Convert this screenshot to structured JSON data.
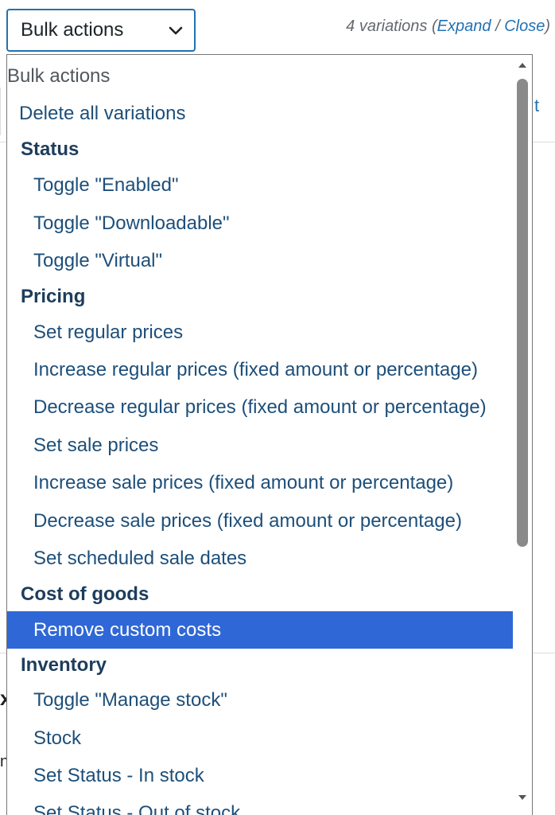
{
  "select": {
    "label": "Bulk actions",
    "icon": "chevron-down-icon"
  },
  "variations": {
    "count_text": "4 variations",
    "open_paren": "(",
    "expand_label": "Expand",
    "separator": " / ",
    "close_label": "Close",
    "close_paren": ")"
  },
  "background": {
    "fragment_right": "t",
    "fragment_heading": "x",
    "fragment_text": "n"
  },
  "dropdown": {
    "options": [
      {
        "label": "Bulk actions",
        "kind": "placeholder"
      },
      {
        "label": "Delete all variations",
        "kind": "top-level"
      },
      {
        "label": "Status",
        "kind": "group"
      },
      {
        "label": "Toggle \"Enabled\"",
        "kind": "child"
      },
      {
        "label": "Toggle \"Downloadable\"",
        "kind": "child"
      },
      {
        "label": "Toggle \"Virtual\"",
        "kind": "child"
      },
      {
        "label": "Pricing",
        "kind": "group"
      },
      {
        "label": "Set regular prices",
        "kind": "child"
      },
      {
        "label": "Increase regular prices (fixed amount or percentage)",
        "kind": "child"
      },
      {
        "label": "Decrease regular prices (fixed amount or percentage)",
        "kind": "child"
      },
      {
        "label": "Set sale prices",
        "kind": "child"
      },
      {
        "label": "Increase sale prices (fixed amount or percentage)",
        "kind": "child"
      },
      {
        "label": "Decrease sale prices (fixed amount or percentage)",
        "kind": "child"
      },
      {
        "label": "Set scheduled sale dates",
        "kind": "child"
      },
      {
        "label": "Cost of goods",
        "kind": "group"
      },
      {
        "label": "Remove custom costs",
        "kind": "child",
        "selected": true
      },
      {
        "label": "Inventory",
        "kind": "group"
      },
      {
        "label": "Toggle \"Manage stock\"",
        "kind": "child"
      },
      {
        "label": "Stock",
        "kind": "child"
      },
      {
        "label": "Set Status - In stock",
        "kind": "child"
      },
      {
        "label": "Set Status - Out of stock",
        "kind": "child"
      }
    ]
  },
  "colors": {
    "accent": "#2271b1",
    "selected_bg": "#2f68d6",
    "option_text": "#1d4f7a",
    "group_text": "#1d3d5c"
  }
}
